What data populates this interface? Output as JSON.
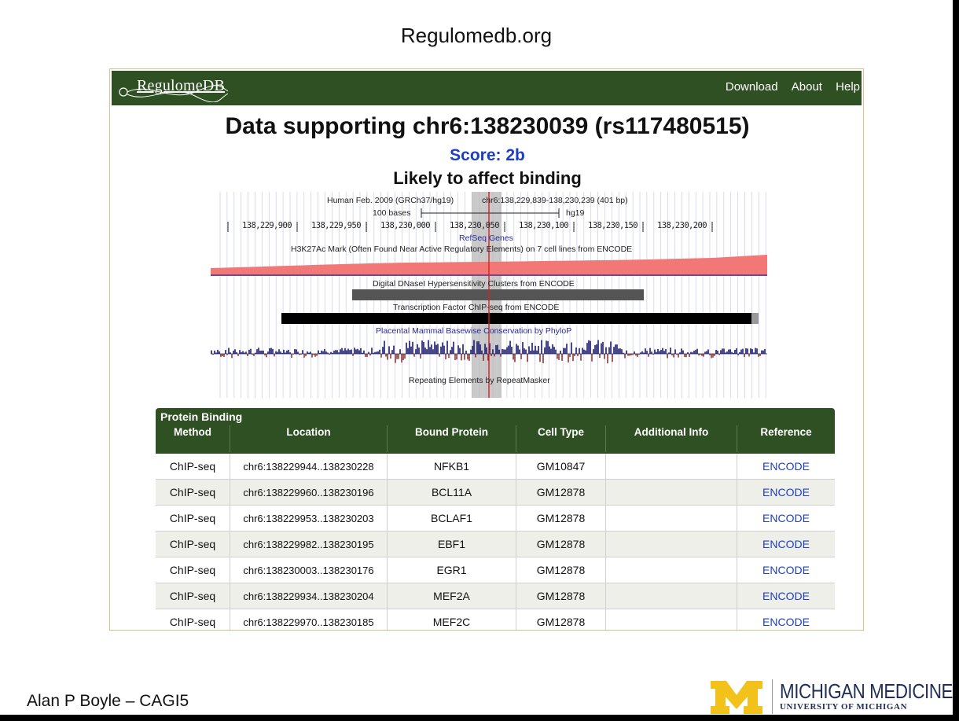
{
  "slide": {
    "title": "Regulomedb.org",
    "presenter": "Alan P Boyle – CAGI5",
    "footer_logo": {
      "name": "MICHIGAN MEDICINE",
      "sub": "UNIVERSITY OF MICHIGAN"
    }
  },
  "site": {
    "logo_text": "RegulomeDB",
    "nav": [
      "Download",
      "About",
      "Help"
    ],
    "heading": "Data supporting chr6:138230039 (rs117480515)",
    "score": "Score: 2b",
    "likely": "Likely to affect binding"
  },
  "browser": {
    "assembly": "Human Feb. 2009 (GRCh37/hg19)",
    "region": "chr6:138,229,839-138,230,239 (401 bp)",
    "scale_label": "100 bases",
    "genome": "hg19",
    "ticks": [
      "138,229,900",
      "138,229,950",
      "138,230,000",
      "138,230,050",
      "138,230,100",
      "138,230,150",
      "138,230,200"
    ],
    "tracks": {
      "refseq": "RefSeq Genes",
      "h3k27ac": "H3K27Ac Mark (Often Found Near Active Regulatory Elements) on 7 cell lines from ENCODE",
      "dnase": "Digital DNaseI Hypersensitivity Clusters from ENCODE",
      "tfbs": "Transcription Factor ChIP-seq from ENCODE",
      "phylop": "Placental Mammal Basewise Conservation by PhyloP",
      "repeat": "Repeating Elements by RepeatMasker"
    },
    "colors": {
      "h3k27ac": "#f27878",
      "highlight": "#b8b8b8",
      "marker": "#d62020",
      "phylop": "#1a1a6e"
    }
  },
  "table": {
    "caption": "Protein Binding",
    "headers": [
      "Method",
      "Location",
      "Bound Protein",
      "Cell Type",
      "Additional Info",
      "Reference"
    ],
    "rows": [
      {
        "method": "ChIP-seq",
        "location": "chr6:138229944..138230228",
        "protein": "NFKB1",
        "cell": "GM10847",
        "info": "",
        "ref": "ENCODE"
      },
      {
        "method": "ChIP-seq",
        "location": "chr6:138229960..138230196",
        "protein": "BCL11A",
        "cell": "GM12878",
        "info": "",
        "ref": "ENCODE"
      },
      {
        "method": "ChIP-seq",
        "location": "chr6:138229953..138230203",
        "protein": "BCLAF1",
        "cell": "GM12878",
        "info": "",
        "ref": "ENCODE"
      },
      {
        "method": "ChIP-seq",
        "location": "chr6:138229982..138230195",
        "protein": "EBF1",
        "cell": "GM12878",
        "info": "",
        "ref": "ENCODE"
      },
      {
        "method": "ChIP-seq",
        "location": "chr6:138230003..138230176",
        "protein": "EGR1",
        "cell": "GM12878",
        "info": "",
        "ref": "ENCODE"
      },
      {
        "method": "ChIP-seq",
        "location": "chr6:138229934..138230204",
        "protein": "MEF2A",
        "cell": "GM12878",
        "info": "",
        "ref": "ENCODE"
      },
      {
        "method": "ChIP-seq",
        "location": "chr6:138229970..138230185",
        "protein": "MEF2C",
        "cell": "GM12878",
        "info": "",
        "ref": "ENCODE"
      }
    ]
  }
}
